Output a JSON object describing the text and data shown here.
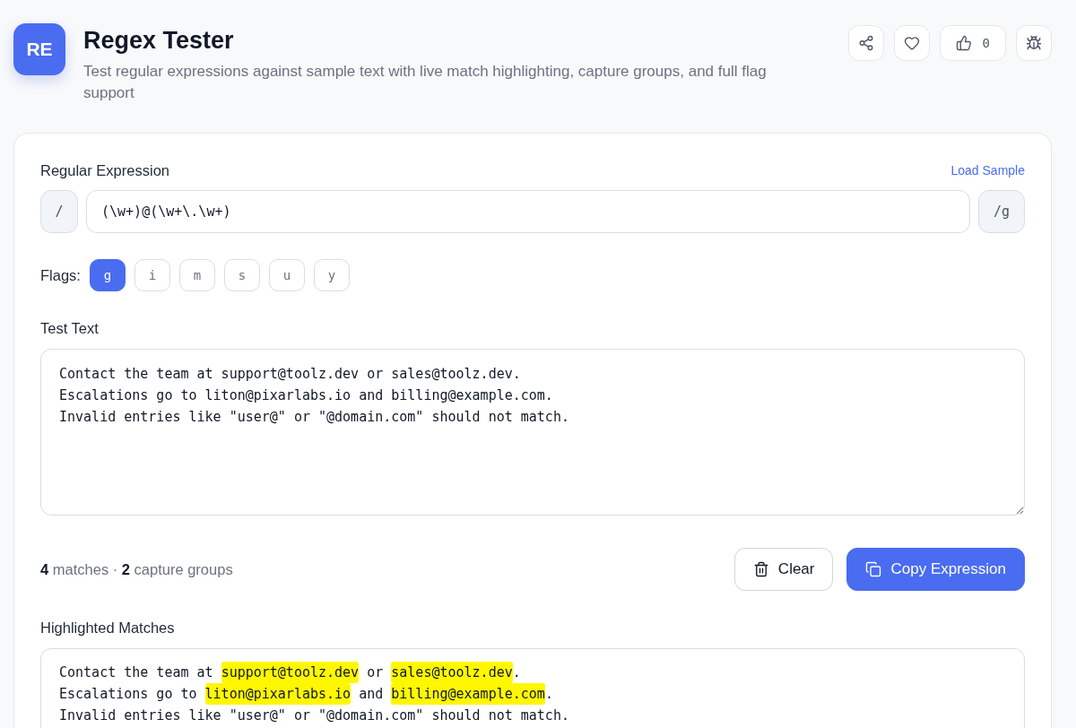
{
  "header": {
    "logo": "RE",
    "title": "Regex Tester",
    "description": "Test regular expressions against sample text with live match highlighting, capture groups, and full flag support",
    "actions": [
      {
        "kind": "share"
      },
      {
        "kind": "favorite"
      },
      {
        "kind": "like",
        "count": "0"
      },
      {
        "kind": "report"
      }
    ]
  },
  "expression": {
    "label": "Regular Expression",
    "link": "Load Sample",
    "prefix": "/",
    "value": "(\\w+)@(\\w+\\.\\w+)",
    "suffix": "/g"
  },
  "flags": {
    "label": "Flags:",
    "items": [
      {
        "label": "g",
        "selected": true
      },
      {
        "label": "i",
        "selected": false
      },
      {
        "label": "m",
        "selected": false
      },
      {
        "label": "s",
        "selected": false
      },
      {
        "label": "u",
        "selected": false
      },
      {
        "label": "y",
        "selected": false
      }
    ]
  },
  "test_text": {
    "label": "Test Text",
    "value": "Contact the team at support@toolz.dev or sales@toolz.dev.\nEscalations go to liton@pixarlabs.io and billing@example.com.\nInvalid entries like \"user@\" or \"@domain.com\" should not match."
  },
  "summary": "**4** matches · **2** capture groups",
  "buttons": [
    {
      "kind": "clear",
      "label": "Clear"
    },
    {
      "kind": "copy",
      "label": "Copy Expression"
    }
  ],
  "highlighted": {
    "label": "Highlighted Matches",
    "lines": [
      {
        "segments": [
          {
            "text": "Contact the team at ",
            "match": false
          },
          {
            "text": "support@toolz.dev",
            "match": true
          },
          {
            "text": " or ",
            "match": false
          },
          {
            "text": "sales@toolz.dev",
            "match": true
          },
          {
            "text": ".",
            "match": false
          }
        ]
      },
      {
        "segments": [
          {
            "text": "Escalations go to ",
            "match": false
          },
          {
            "text": "liton@pixarlabs.io",
            "match": true
          },
          {
            "text": " and ",
            "match": false
          },
          {
            "text": "billing@example.com",
            "match": true
          },
          {
            "text": ".",
            "match": false
          }
        ]
      },
      {
        "segments": [
          {
            "text": "Invalid entries like \"user@\" or \"@domain.com\" should not match.",
            "match": false
          }
        ]
      }
    ]
  }
}
